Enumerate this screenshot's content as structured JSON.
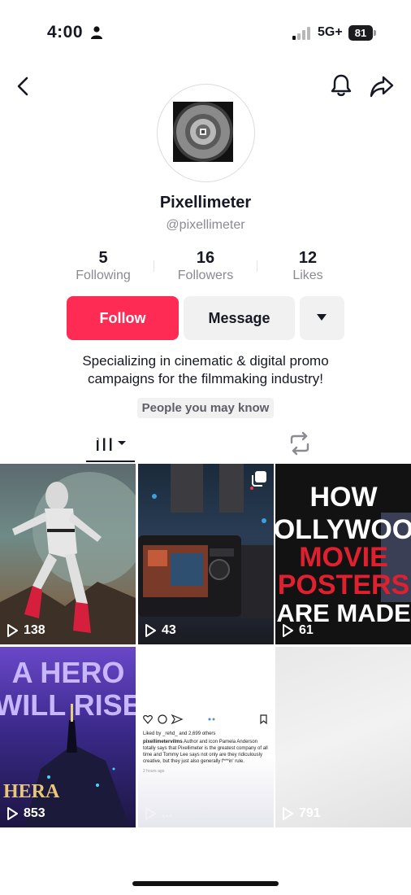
{
  "status_bar": {
    "time": "4:00",
    "network": "5G+",
    "battery": "81"
  },
  "header": {
    "back_icon": "chevron-left-icon",
    "bell_icon": "bell-icon",
    "share_icon": "share-icon"
  },
  "profile": {
    "name": "Pixellimeter",
    "handle": "@pixellimeter",
    "bio_line1": "Specializing in cinematic & digital promo",
    "bio_line2": "campaigns for the filmmaking industry!"
  },
  "stats": [
    {
      "value": "5",
      "label": "Following"
    },
    {
      "value": "16",
      "label": "Followers"
    },
    {
      "value": "12",
      "label": "Likes"
    }
  ],
  "actions": {
    "follow": "Follow",
    "message": "Message"
  },
  "suggest": "People you may know",
  "tabs": {
    "videos_icon": "grid-icon",
    "reposts_icon": "repost-icon"
  },
  "accent_color": "#fe2c55",
  "videos": [
    {
      "views": "138"
    },
    {
      "views": "43"
    },
    {
      "views": "61",
      "title_l1": "HOW",
      "title_l2": "OLLYWOO",
      "title_l3": "MOVIE",
      "title_l4": "POSTERS",
      "title_l5": "ARE MADE"
    },
    {
      "views": "853",
      "title_l1": "A HERO",
      "title_l2": "WILL RISE",
      "logo": "HERA"
    },
    {
      "views": "...",
      "liked_by": "Liked by _rehd_ and 2,699 others",
      "caption_user": "pixellimetervilms",
      "caption": "Author and icon Pamela Anderson totally says that Pixellimeter is the greatest company of all time and Tommy Lee says not only are they ridiculously creative, but they just also generally f***in' rule.",
      "time_ago": "2 hours ago"
    },
    {
      "views": "791"
    }
  ]
}
